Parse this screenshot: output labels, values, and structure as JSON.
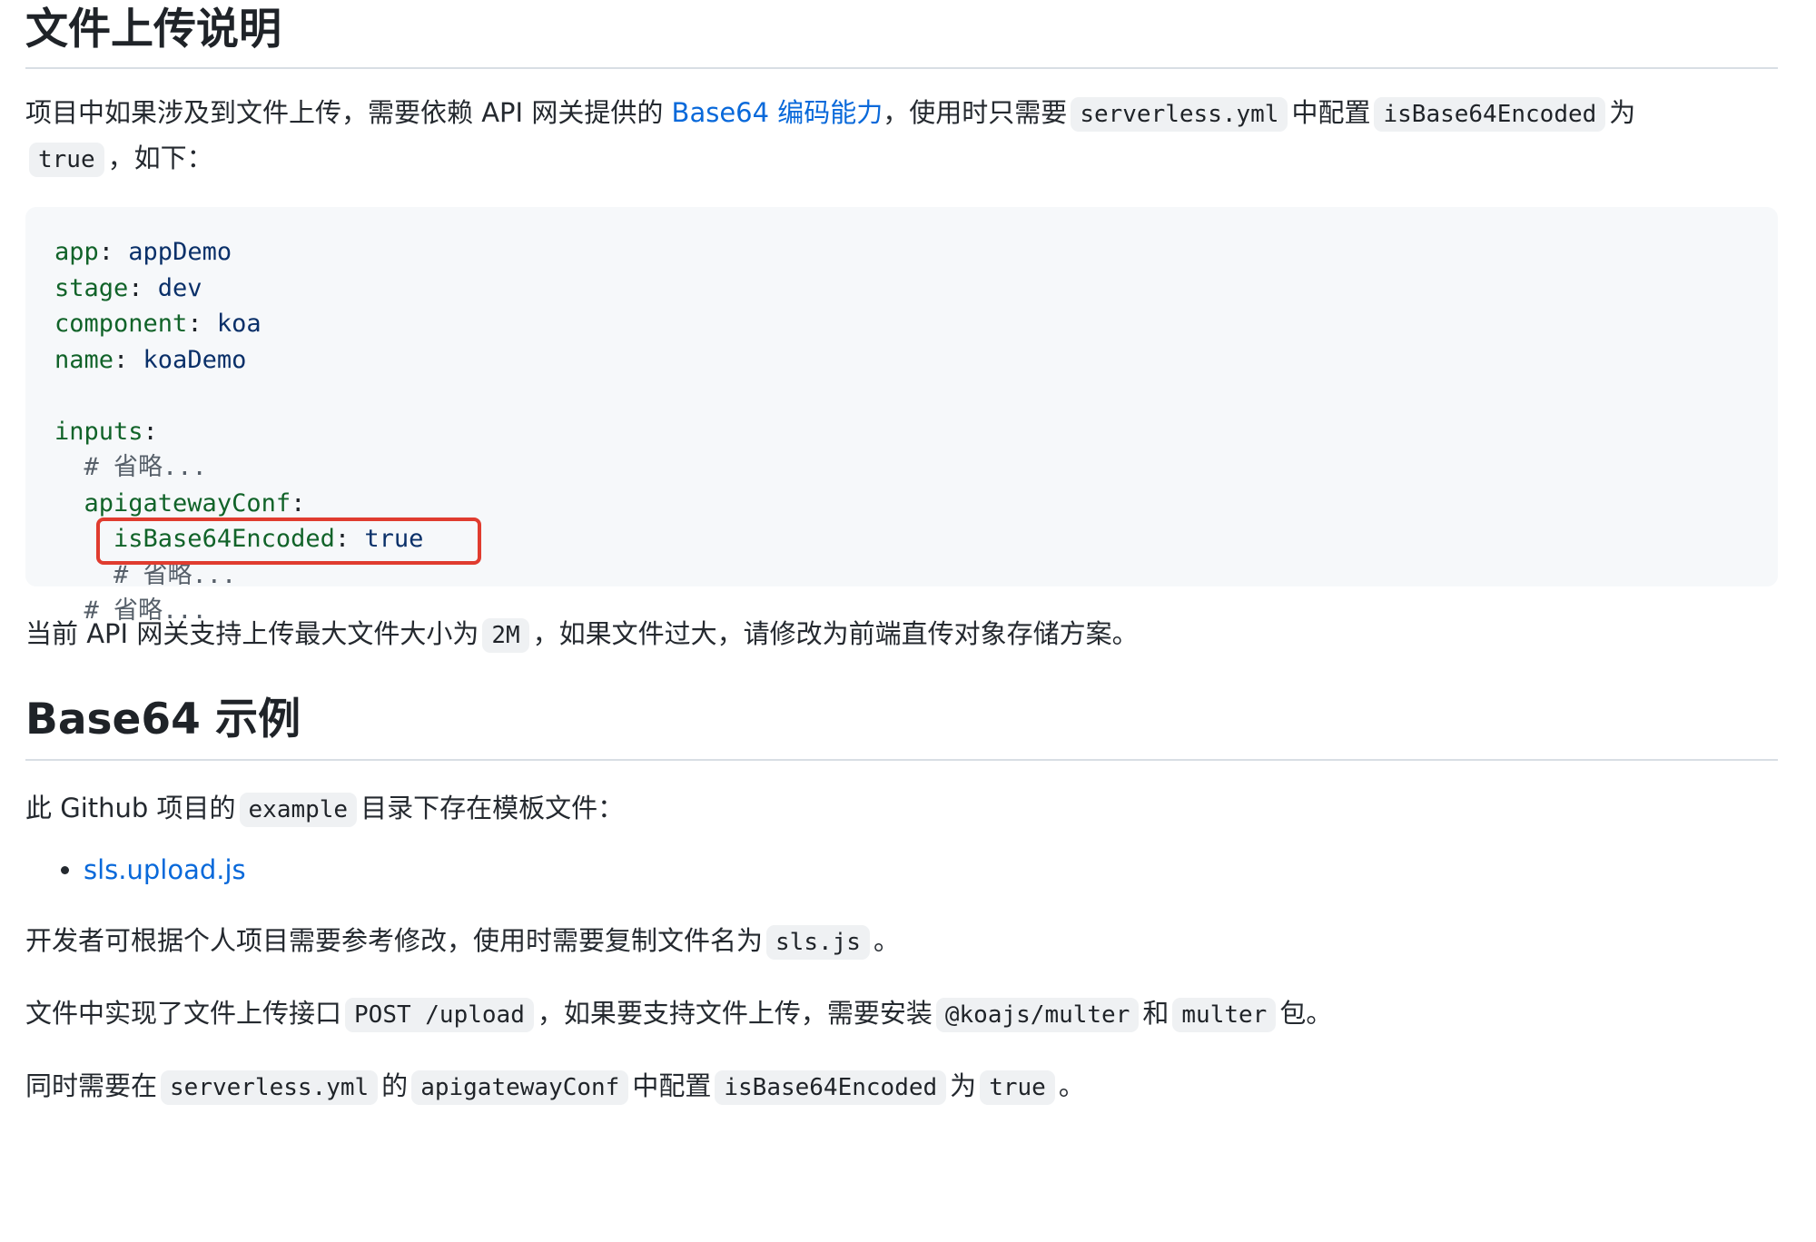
{
  "section1": {
    "title": "文件上传说明",
    "intro": {
      "text1": "项目中如果涉及到文件上传，需要依赖 API 网关提供的",
      "link": "Base64 编码能力",
      "text2": "，使用时只需要",
      "code1": "serverless.yml",
      "text3": "中配置",
      "code2": "isBase64Encoded",
      "text4": "为",
      "code3": "true",
      "text5": "，如下："
    },
    "code_block": {
      "app_key": "app",
      "app_val": "appDemo",
      "stage_key": "stage",
      "stage_val": "dev",
      "component_key": "component",
      "component_val": "koa",
      "name_key": "name",
      "name_val": "koaDemo",
      "inputs_key": "inputs",
      "comment1": "# 省略...",
      "apigw_key": "apigatewayConf",
      "encoded_key": "isBase64Encoded",
      "encoded_val": "true",
      "comment2": "# 省略...",
      "comment3": "# 省略..."
    },
    "size_note": {
      "text1": "当前 API 网关支持上传最大文件大小为",
      "code": "2M",
      "text2": "，如果文件过大，请修改为前端直传对象存储方案。"
    }
  },
  "section2": {
    "title": "Base64 示例",
    "intro": {
      "text1": "此 Github 项目的",
      "code": "example",
      "text2": "目录下存在模板文件："
    },
    "files": [
      {
        "label": "sls.upload.js"
      }
    ],
    "p1": {
      "text1": "开发者可根据个人项目需要参考修改，使用时需要复制文件名为",
      "code": "sls.js",
      "text2": "。"
    },
    "p2": {
      "text1": "文件中实现了文件上传接口",
      "code1": "POST /upload",
      "text2": "，如果要支持文件上传，需要安装",
      "code2": "@koajs/multer",
      "text3": "和",
      "code3": "multer",
      "text4": "包。"
    },
    "p3": {
      "text1": "同时需要在",
      "code1": "serverless.yml",
      "text2": "的",
      "code2": "apigatewayConf",
      "text3": "中配置",
      "code3": "isBase64Encoded",
      "text4": "为",
      "code4": "true",
      "text5": "。"
    }
  },
  "colors": {
    "link": "#0969da",
    "highlight_box": "#e03c2f",
    "code_bg": "#f6f8fa",
    "yaml_key": "#116329",
    "yaml_value": "#0a3069"
  }
}
